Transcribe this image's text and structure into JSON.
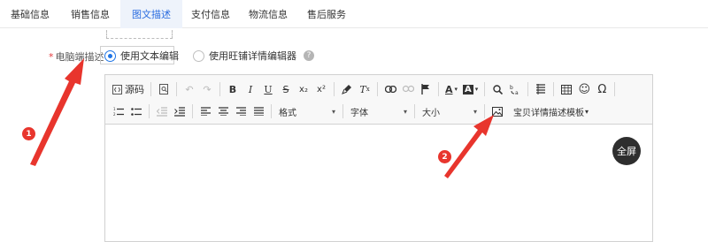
{
  "tabs": [
    {
      "label": "基础信息",
      "active": false
    },
    {
      "label": "销售信息",
      "active": false
    },
    {
      "label": "图文描述",
      "active": true
    },
    {
      "label": "支付信息",
      "active": false
    },
    {
      "label": "物流信息",
      "active": false
    },
    {
      "label": "售后服务",
      "active": false
    }
  ],
  "field": {
    "required_mark": "*",
    "label": "电脑端描述",
    "options": [
      {
        "label": "使用文本编辑",
        "selected": true
      },
      {
        "label": "使用旺铺详情编辑器",
        "selected": false
      }
    ],
    "help": "?"
  },
  "toolbar": {
    "source_label": "源码",
    "bold": "B",
    "italic": "I",
    "underline": "U",
    "strike": "S",
    "subscript": "x₂",
    "superscript": "x²",
    "clear_format": "T",
    "font_color": "A",
    "bg_color": "A",
    "special_char": "Ω",
    "emoji": "☺",
    "format_combo": "格式",
    "font_combo": "字体",
    "size_combo": "大小",
    "template_label": "宝贝详情描述模板"
  },
  "fullscreen_label": "全屏",
  "annotations": [
    {
      "number": "1"
    },
    {
      "number": "2"
    }
  ],
  "colors": {
    "accent": "#1e74e6",
    "active_tab_bg": "#eef3fb",
    "annotation_red": "#e8352d",
    "fullscreen_bg": "#2e2e2e"
  }
}
